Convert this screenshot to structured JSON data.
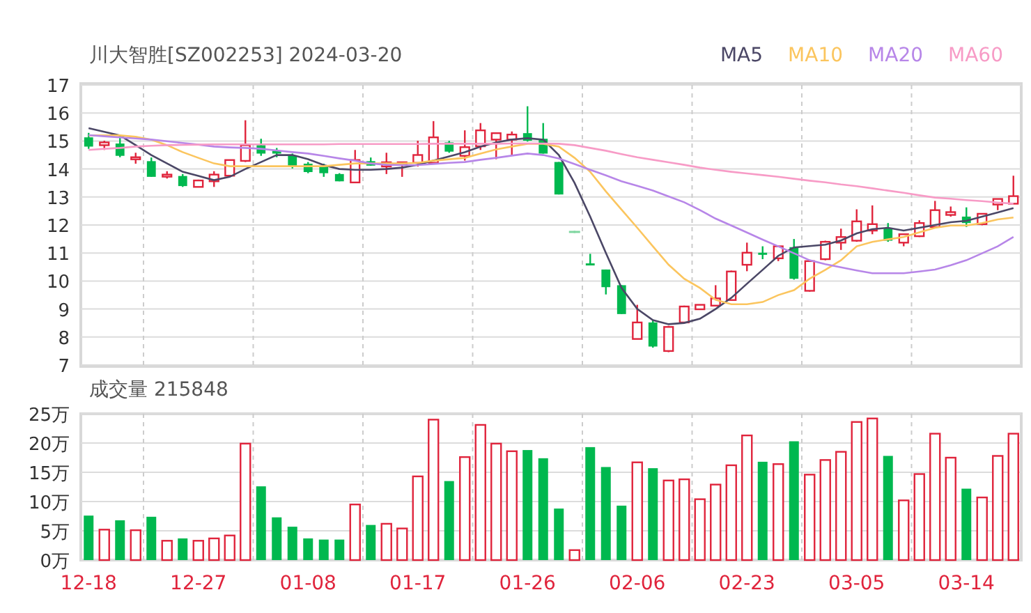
{
  "header": {
    "title": "川大智胜[SZ002253] 2024-03-20"
  },
  "price_chart": {
    "chart_data": {
      "type": "candlestick",
      "grid": true,
      "yticks": [
        7,
        8,
        9,
        10,
        11,
        12,
        13,
        14,
        15,
        16,
        17
      ],
      "ylim": [
        7,
        17
      ],
      "categories": [
        null,
        null,
        null,
        null,
        null,
        null,
        null,
        null,
        null,
        null,
        null,
        null,
        null,
        null,
        null,
        null,
        null,
        null,
        null,
        null,
        null,
        null,
        null,
        null,
        null,
        null,
        null,
        null,
        null,
        null,
        null,
        null,
        null,
        null,
        null,
        null,
        null,
        null,
        null,
        null,
        null,
        null,
        null,
        null,
        null,
        null,
        null,
        null,
        null,
        null,
        null,
        null,
        null,
        null,
        null,
        null,
        null,
        null,
        null,
        null
      ],
      "ohlc": [
        [
          15.13,
          15.29,
          14.72,
          14.8
        ],
        [
          14.85,
          15.01,
          14.68,
          14.95
        ],
        [
          14.91,
          15.21,
          14.42,
          14.47
        ],
        [
          14.35,
          14.58,
          14.19,
          14.42
        ],
        [
          14.28,
          14.41,
          13.72,
          13.72
        ],
        [
          13.78,
          13.92,
          13.66,
          13.8
        ],
        [
          13.75,
          13.82,
          13.36,
          13.39
        ],
        [
          13.36,
          13.62,
          13.36,
          13.59
        ],
        [
          13.56,
          13.92,
          13.36,
          13.8
        ],
        [
          13.76,
          14.32,
          13.72,
          14.32
        ],
        [
          14.29,
          15.74,
          14.25,
          14.85
        ],
        [
          14.85,
          15.08,
          14.47,
          14.55
        ],
        [
          14.65,
          14.75,
          14.42,
          14.55
        ],
        [
          14.48,
          14.55,
          14.02,
          14.09
        ],
        [
          14.19,
          14.25,
          13.85,
          13.89
        ],
        [
          14.09,
          14.19,
          13.72,
          13.85
        ],
        [
          13.82,
          13.85,
          13.56,
          13.56
        ],
        [
          13.52,
          14.68,
          13.52,
          14.32
        ],
        [
          14.28,
          14.41,
          14.12,
          14.12
        ],
        [
          14.09,
          14.58,
          13.82,
          14.24
        ],
        [
          14.15,
          14.24,
          13.72,
          14.24
        ],
        [
          14.22,
          15.01,
          14.09,
          14.5
        ],
        [
          14.22,
          15.71,
          14.22,
          15.13
        ],
        [
          14.95,
          15.01,
          14.58,
          14.62
        ],
        [
          14.47,
          15.38,
          14.3,
          14.78
        ],
        [
          14.81,
          15.64,
          14.68,
          15.38
        ],
        [
          15.05,
          15.28,
          14.35,
          15.28
        ],
        [
          15.05,
          15.34,
          14.47,
          15.23
        ],
        [
          15.28,
          16.24,
          14.98,
          15.01
        ],
        [
          15.08,
          15.64,
          14.55,
          14.55
        ],
        [
          14.25,
          14.25,
          13.09,
          13.09
        ],
        [
          11.79,
          11.79,
          11.79,
          11.79
        ],
        [
          10.63,
          10.97,
          10.56,
          10.59
        ],
        [
          10.41,
          10.41,
          9.52,
          9.78
        ],
        [
          9.85,
          9.85,
          8.82,
          8.82
        ],
        [
          7.93,
          9.15,
          7.93,
          8.52
        ],
        [
          8.52,
          8.62,
          7.62,
          7.66
        ],
        [
          7.5,
          8.4,
          7.46,
          8.36
        ],
        [
          8.52,
          9.12,
          8.52,
          9.09
        ],
        [
          8.99,
          9.15,
          8.99,
          9.15
        ],
        [
          9.12,
          9.85,
          9.09,
          9.38
        ],
        [
          9.32,
          10.37,
          9.32,
          10.34
        ],
        [
          10.58,
          11.37,
          10.35,
          11.01
        ],
        [
          11.01,
          11.24,
          10.78,
          10.94
        ],
        [
          10.81,
          11.24,
          10.71,
          11.24
        ],
        [
          11.21,
          11.5,
          10.05,
          10.08
        ],
        [
          9.65,
          10.71,
          9.62,
          10.71
        ],
        [
          10.78,
          11.44,
          10.74,
          11.4
        ],
        [
          11.37,
          11.87,
          11.11,
          11.57
        ],
        [
          11.44,
          12.56,
          11.4,
          12.13
        ],
        [
          11.8,
          12.7,
          11.67,
          12.03
        ],
        [
          11.9,
          12.07,
          11.4,
          11.44
        ],
        [
          11.37,
          11.67,
          11.24,
          11.67
        ],
        [
          11.6,
          12.17,
          11.57,
          12.07
        ],
        [
          11.93,
          12.86,
          11.9,
          12.53
        ],
        [
          12.36,
          12.66,
          12.3,
          12.46
        ],
        [
          12.3,
          12.63,
          11.93,
          12.07
        ],
        [
          12.03,
          12.4,
          11.99,
          12.4
        ],
        [
          12.73,
          12.93,
          12.53,
          12.93
        ],
        [
          12.76,
          13.76,
          12.76,
          13.03
        ]
      ]
    }
  },
  "moving_averages": {
    "chart_data": {
      "type": "line",
      "ylim": [
        7,
        17
      ],
      "categories": [
        null,
        null,
        null,
        null,
        null,
        null,
        null,
        null,
        null,
        null,
        null,
        null,
        null,
        null,
        null,
        null,
        null,
        null,
        null,
        null,
        null,
        null,
        null,
        null,
        null,
        null,
        null,
        null,
        null,
        null,
        null,
        null,
        null,
        null,
        null,
        null,
        null,
        null,
        null,
        null,
        null,
        null,
        null,
        null,
        null,
        null,
        null,
        null,
        null,
        null,
        null,
        null,
        null,
        null,
        null,
        null,
        null,
        null,
        null,
        null
      ],
      "series": [
        {
          "name": "MA5",
          "color": "#4b4766",
          "values": [
            15.46,
            15.33,
            15.2,
            14.85,
            14.5,
            14.2,
            13.9,
            13.75,
            13.6,
            13.72,
            14.0,
            14.25,
            14.5,
            14.5,
            14.35,
            14.14,
            14.0,
            13.97,
            13.97,
            14.0,
            14.05,
            14.15,
            14.3,
            14.45,
            14.6,
            14.8,
            14.95,
            15.05,
            15.1,
            15.05,
            14.5,
            13.5,
            12.3,
            11.0,
            9.75,
            9.0,
            8.6,
            8.46,
            8.5,
            8.65,
            9.0,
            9.4,
            9.9,
            10.4,
            10.9,
            11.2,
            11.25,
            11.3,
            11.45,
            11.7,
            11.85,
            11.9,
            11.8,
            11.9,
            12.0,
            12.1,
            12.15,
            12.3,
            12.45,
            12.6
          ]
        },
        {
          "name": "MA10",
          "color": "#fbc55e",
          "values": [
            15.2,
            15.2,
            15.2,
            15.15,
            15.05,
            14.85,
            14.6,
            14.4,
            14.2,
            14.1,
            14.1,
            14.1,
            14.1,
            14.1,
            14.1,
            14.1,
            14.15,
            14.2,
            14.2,
            14.2,
            14.2,
            14.22,
            14.3,
            14.35,
            14.4,
            14.55,
            14.7,
            14.8,
            14.9,
            14.9,
            14.8,
            14.4,
            13.9,
            13.2,
            12.55,
            11.9,
            11.24,
            10.58,
            10.08,
            9.75,
            9.33,
            9.17,
            9.17,
            9.25,
            9.5,
            9.67,
            10.08,
            10.4,
            10.74,
            11.24,
            11.4,
            11.49,
            11.57,
            11.74,
            11.9,
            11.98,
            11.98,
            12.07,
            12.2,
            12.27
          ]
        },
        {
          "name": "MA20",
          "color": "#b786e8",
          "values": [
            15.21,
            15.17,
            15.13,
            15.09,
            15.05,
            14.99,
            14.93,
            14.87,
            14.8,
            14.77,
            14.75,
            14.72,
            14.66,
            14.6,
            14.55,
            14.47,
            14.38,
            14.3,
            14.2,
            14.15,
            14.14,
            14.14,
            14.18,
            14.22,
            14.25,
            14.33,
            14.4,
            14.48,
            14.55,
            14.5,
            14.38,
            14.18,
            13.97,
            13.77,
            13.56,
            13.4,
            13.23,
            13.02,
            12.81,
            12.53,
            12.23,
            11.98,
            11.73,
            11.48,
            11.24,
            10.99,
            10.74,
            10.6,
            10.49,
            10.38,
            10.28,
            10.28,
            10.28,
            10.34,
            10.41,
            10.56,
            10.74,
            10.99,
            11.24,
            11.57
          ]
        },
        {
          "name": "MA60",
          "color": "#f79bc6",
          "values": [
            14.68,
            14.72,
            14.75,
            14.8,
            14.83,
            14.85,
            14.86,
            14.87,
            14.88,
            14.88,
            14.88,
            14.88,
            14.88,
            14.88,
            14.88,
            14.88,
            14.89,
            14.89,
            14.89,
            14.89,
            14.89,
            14.89,
            14.9,
            14.9,
            14.9,
            14.9,
            14.9,
            14.91,
            14.91,
            14.91,
            14.9,
            14.85,
            14.75,
            14.65,
            14.53,
            14.42,
            14.33,
            14.24,
            14.15,
            14.05,
            13.97,
            13.9,
            13.84,
            13.78,
            13.72,
            13.65,
            13.58,
            13.52,
            13.45,
            13.39,
            13.31,
            13.23,
            13.15,
            13.06,
            12.98,
            12.94,
            12.89,
            12.85,
            12.8,
            12.76
          ]
        }
      ]
    }
  },
  "volume_chart": {
    "title": "成交量 215848",
    "chart_data": {
      "type": "bar",
      "grid": true,
      "ylim": [
        0,
        25
      ],
      "yticks": [
        {
          "value": 0,
          "label": "0万"
        },
        {
          "value": 5,
          "label": "5万"
        },
        {
          "value": 10,
          "label": "10万"
        },
        {
          "value": 15,
          "label": "15万"
        },
        {
          "value": 20,
          "label": "20万"
        },
        {
          "value": 25,
          "label": "25万"
        }
      ],
      "categories": [
        "12-18",
        null,
        null,
        null,
        null,
        null,
        null,
        "12-27",
        null,
        null,
        null,
        null,
        null,
        null,
        "01-08",
        null,
        null,
        null,
        null,
        null,
        null,
        "01-17",
        null,
        null,
        null,
        null,
        null,
        null,
        "01-26",
        null,
        null,
        null,
        null,
        null,
        null,
        "02-06",
        null,
        null,
        null,
        null,
        null,
        null,
        "02-23",
        null,
        null,
        null,
        null,
        null,
        null,
        "03-05",
        null,
        null,
        null,
        null,
        null,
        null,
        "03-14",
        null,
        null,
        null
      ],
      "values": [
        7.6,
        5.2,
        6.8,
        5.1,
        7.4,
        3.3,
        3.7,
        3.3,
        3.7,
        4.2,
        19.9,
        12.6,
        7.3,
        5.7,
        3.7,
        3.5,
        3.5,
        9.5,
        6.0,
        6.2,
        5.4,
        14.3,
        24.0,
        13.5,
        17.6,
        23.1,
        19.9,
        18.6,
        18.8,
        17.4,
        8.8,
        1.7,
        19.3,
        15.9,
        9.3,
        16.7,
        15.7,
        13.6,
        13.8,
        10.4,
        12.9,
        16.2,
        21.3,
        16.8,
        16.4,
        20.3,
        14.6,
        17.1,
        18.5,
        23.6,
        24.2,
        17.8,
        10.2,
        14.7,
        21.6,
        17.5,
        12.2,
        10.7,
        17.8,
        21.6
      ]
    }
  }
}
